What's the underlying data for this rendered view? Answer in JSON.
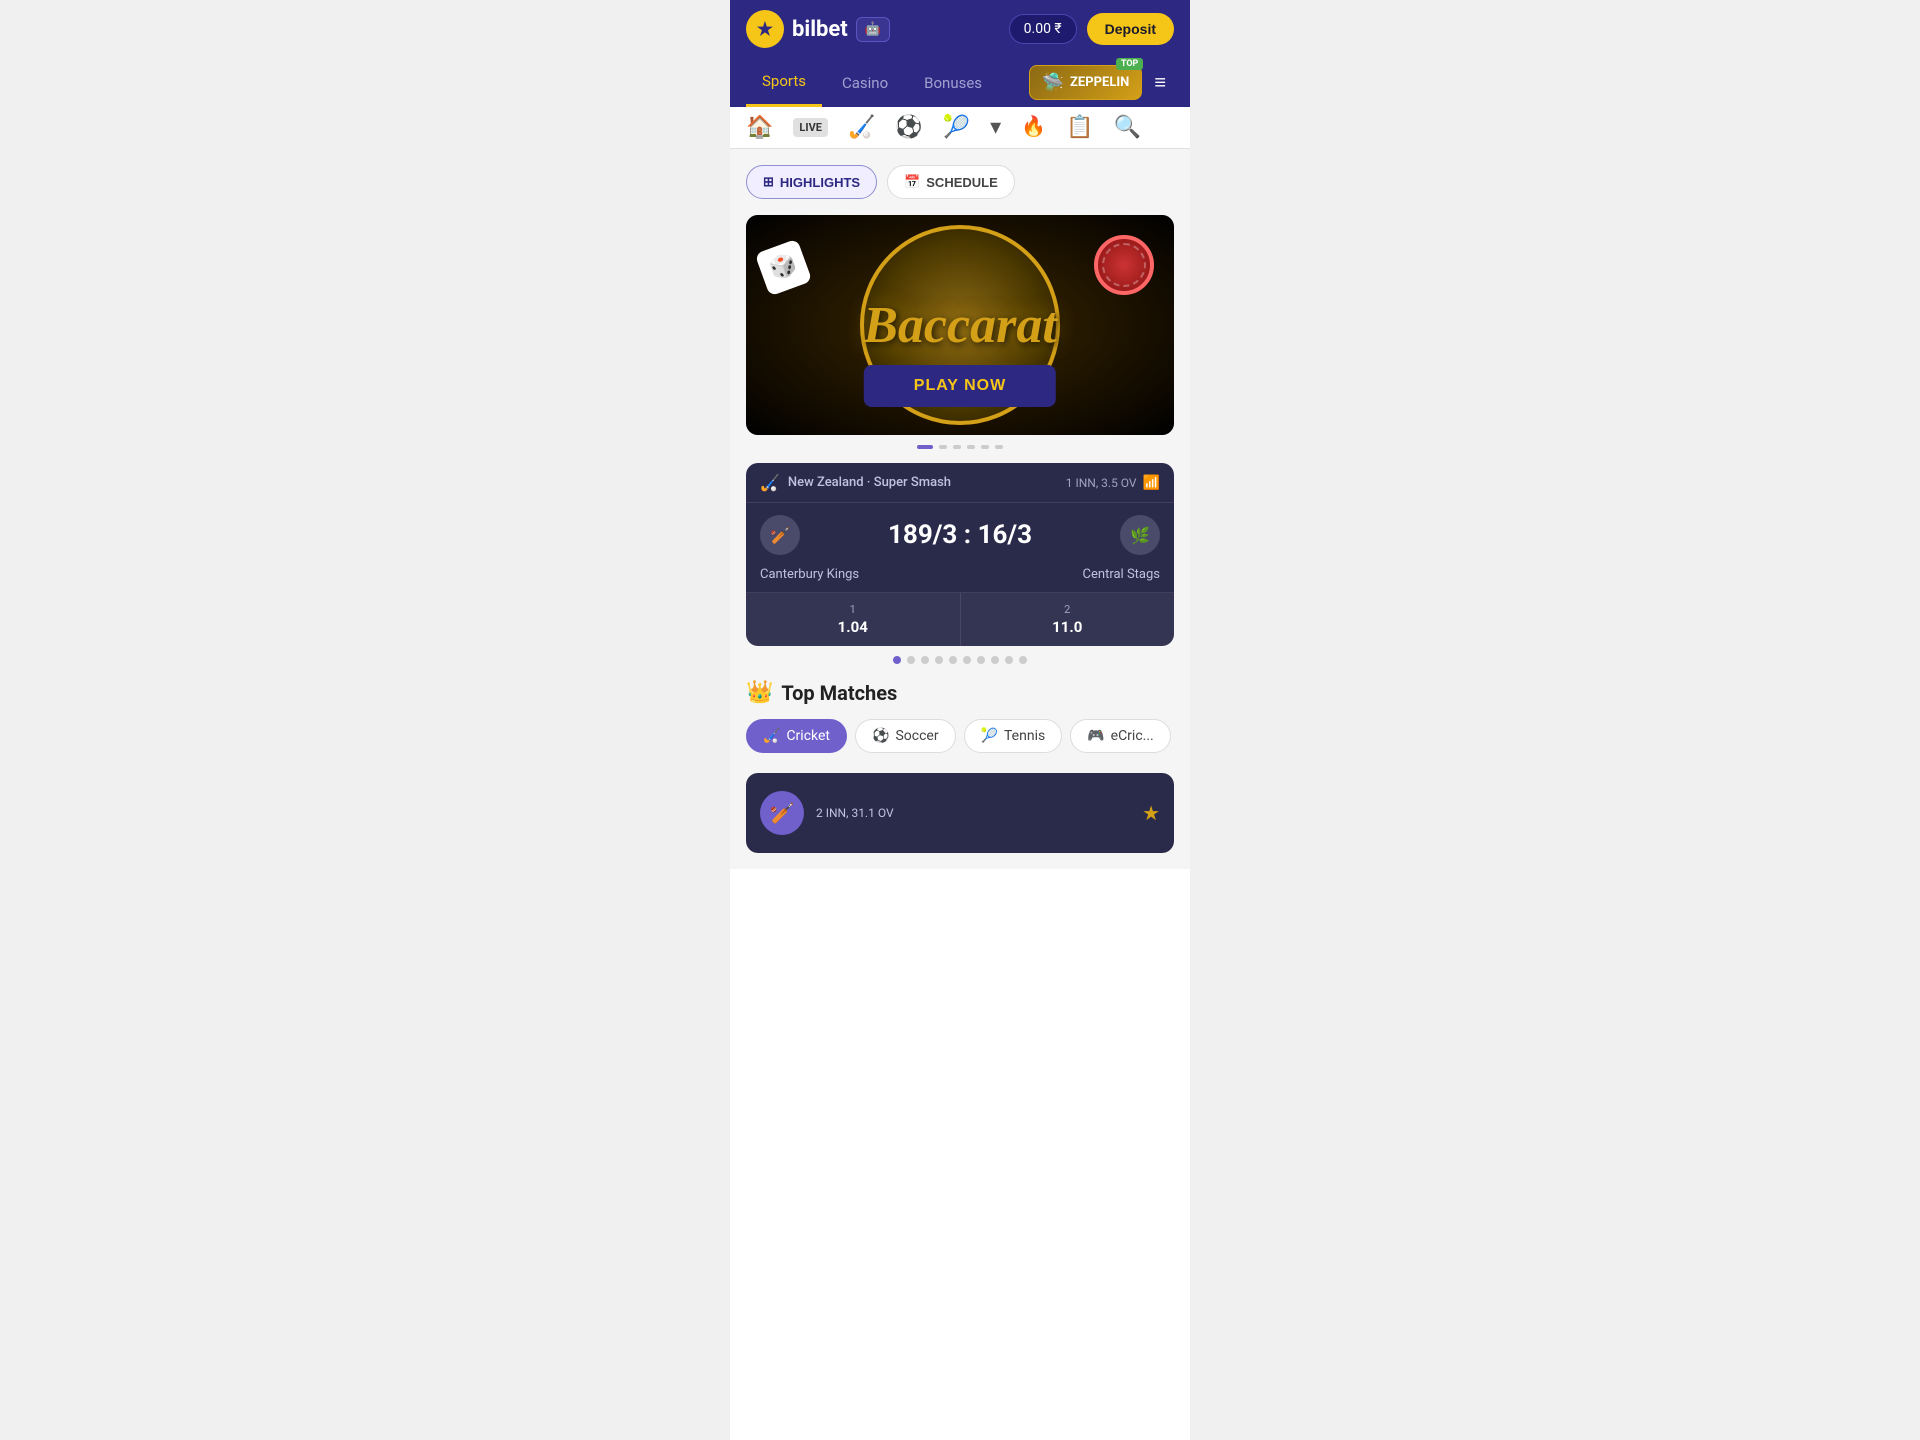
{
  "header": {
    "logo_text": "bilbet",
    "android_label": "🤖",
    "balance": "0.00 ₹",
    "deposit_label": "Deposit"
  },
  "nav": {
    "items": [
      {
        "id": "sports",
        "label": "Sports",
        "active": true
      },
      {
        "id": "casino",
        "label": "Casino",
        "active": false
      },
      {
        "id": "bonuses",
        "label": "Bonuses",
        "active": false
      }
    ],
    "zeppelin_label": "ZEPPELIN",
    "top_badge": "TOP",
    "menu_icon": "≡"
  },
  "toolbar": {
    "icons": [
      {
        "id": "home",
        "symbol": "🏠",
        "active": true
      },
      {
        "id": "live",
        "label": "LIVE"
      },
      {
        "id": "esports",
        "symbol": "🏑"
      },
      {
        "id": "soccer",
        "symbol": "⚽"
      },
      {
        "id": "tennis",
        "symbol": "🎾"
      },
      {
        "id": "fire",
        "symbol": "🔥"
      },
      {
        "id": "notes",
        "symbol": "📋"
      },
      {
        "id": "search",
        "symbol": "🔍"
      }
    ]
  },
  "tabs": {
    "highlights": "HIGHLIGHTS",
    "schedule": "SCHEDULE"
  },
  "banner": {
    "title": "Baccarat",
    "play_now": "PLAY NOW"
  },
  "banner_dots": [
    {
      "active": true
    },
    {
      "active": false
    },
    {
      "active": false
    },
    {
      "active": false
    },
    {
      "active": false
    },
    {
      "active": false
    }
  ],
  "match": {
    "league": "New Zealand · Super Smash",
    "innings": "1 INN, 3.5 OV",
    "team1_name": "Canterbury Kings",
    "team2_name": "Central Stags",
    "score": "189/3 : 16/3",
    "odd1_num": "1",
    "odd1_val": "1.04",
    "odd2_num": "2",
    "odd2_val": "11.0"
  },
  "match_dots": [
    {
      "active": true
    },
    {
      "active": false
    },
    {
      "active": false
    },
    {
      "active": false
    },
    {
      "active": false
    },
    {
      "active": false
    },
    {
      "active": false
    },
    {
      "active": false
    },
    {
      "active": false
    },
    {
      "active": false
    }
  ],
  "top_matches": {
    "title": "Top Matches",
    "filters": [
      {
        "id": "cricket",
        "label": "Cricket",
        "icon": "🏑",
        "active": true
      },
      {
        "id": "soccer",
        "label": "Soccer",
        "icon": "⚽",
        "active": false
      },
      {
        "id": "tennis",
        "label": "Tennis",
        "icon": "🎾",
        "active": false
      },
      {
        "id": "ecricket",
        "label": "eCric...",
        "icon": "🎮",
        "active": false
      }
    ]
  },
  "bottom_match": {
    "info": "2 INN, 31.1 OV"
  }
}
